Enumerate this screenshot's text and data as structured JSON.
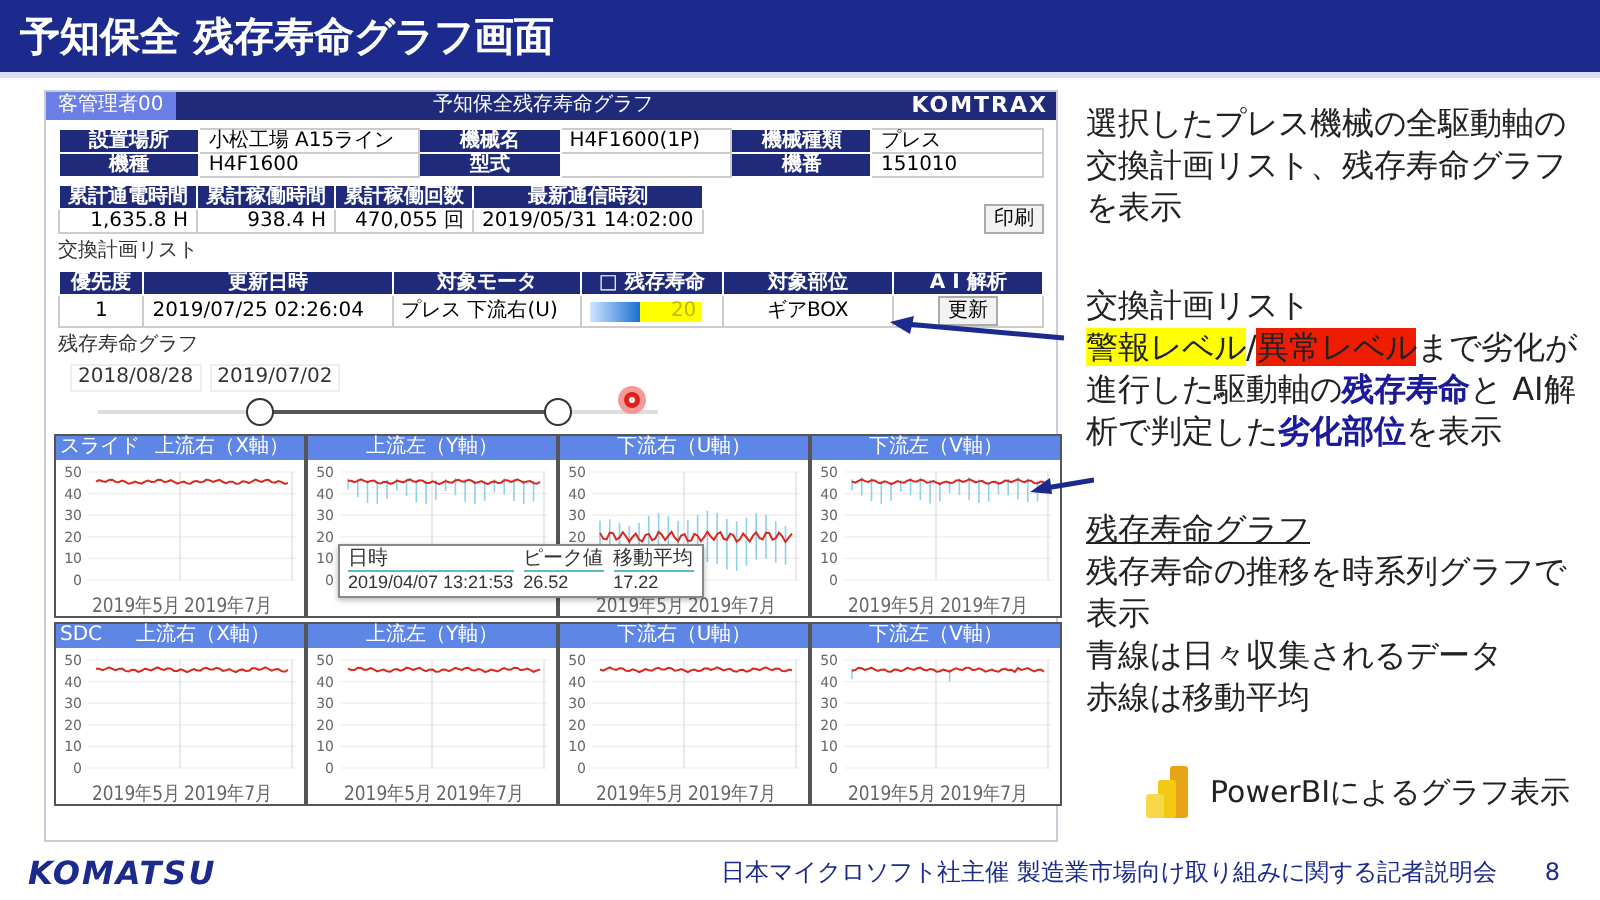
{
  "slide_title": "予知保全 残存寿命グラフ画面",
  "app": {
    "user": "客管理者00",
    "title": "予知保全残存寿命グラフ",
    "brand": "KOMTRAX",
    "info_rows": [
      [
        "設置場所",
        "小松工場 A15ライン",
        "機械名",
        "H4F1600(1P)",
        "機械種類",
        "プレス"
      ],
      [
        "機種",
        "H4F1600",
        "型式",
        "",
        "機番",
        "151010"
      ]
    ],
    "stats": {
      "columns": [
        "累計通電時間",
        "累計稼働時間",
        "累計稼働回数",
        "最新通信時刻"
      ],
      "values": [
        "1,635.8 H",
        "938.4 H",
        "470,055 回",
        "2019/05/31 14:02:00"
      ]
    },
    "print_button": "印刷",
    "list_title": "交換計画リスト",
    "list_columns": [
      "優先度",
      "更新日時",
      "対象モータ",
      "□ 残存寿命",
      "対象部位",
      "A I 解析"
    ],
    "list_rows": [
      {
        "priority": "1",
        "updated": "2019/07/25 02:26:04",
        "motor": "プレス 下流右(U)",
        "life": {
          "level": 0.45,
          "value": "20",
          "color": "#ffff00"
        },
        "part": "ギアBOX",
        "action": "更新"
      }
    ],
    "graph_title": "残存寿命グラフ",
    "dates": [
      "2018/08/28",
      "2019/07/02"
    ],
    "range_handles": [
      {
        "level": 0.29
      },
      {
        "level": 0.82
      }
    ],
    "chart_rows": [
      {
        "label": "スライド",
        "charts": [
          {
            "title": "上流右（X軸）",
            "kind": "flat",
            "y_labels": [
              "50",
              "40",
              "30",
              "20",
              "10",
              "0"
            ],
            "x_labels": [
              "2019年5月",
              "2019年7月"
            ]
          },
          {
            "title": "上流左（Y軸）",
            "kind": "spiky",
            "y_labels": [
              "50",
              "40",
              "30",
              "20",
              "10",
              "0"
            ]
          },
          {
            "title": "下流右（U軸）",
            "kind": "low",
            "y_labels": [
              "50",
              "40",
              "30",
              "20"
            ],
            "x_labels": [
              "2019年5月",
              "2019年7月"
            ]
          },
          {
            "title": "下流左（V軸）",
            "kind": "spiky",
            "y_labels": [
              "50",
              "40",
              "30",
              "20",
              "10",
              "0"
            ],
            "x_labels": [
              "2019年5月",
              "2019年7月"
            ]
          }
        ]
      },
      {
        "label": "SDC",
        "charts": [
          {
            "title": "上流右（X軸）",
            "kind": "flat",
            "y_labels": [
              "50",
              "40",
              "30",
              "20",
              "10",
              "0"
            ],
            "x_labels": [
              "2019年5月",
              "2019年7月"
            ]
          },
          {
            "title": "上流左（Y軸）",
            "kind": "flat",
            "y_labels": [
              "50",
              "40",
              "30",
              "20",
              "10",
              "0"
            ],
            "x_labels": [
              "2019年5月",
              "2019年7月"
            ]
          },
          {
            "title": "下流右（U軸）",
            "kind": "flat",
            "y_labels": [
              "50",
              "40",
              "30",
              "20",
              "10",
              "0"
            ],
            "x_labels": [
              "2019年5月",
              "2019年7月"
            ]
          },
          {
            "title": "下流左（V軸）",
            "kind": "dip",
            "y_labels": [
              "50",
              "40",
              "30",
              "20",
              "10",
              "0"
            ],
            "x_labels": [
              "2019年5月",
              "2019年7月"
            ]
          }
        ]
      }
    ],
    "tooltip": {
      "columns": [
        "日時",
        "ピーク値",
        "移動平均"
      ],
      "values": [
        "2019/04/07 13:21:53",
        "26.52",
        "17.22"
      ]
    }
  },
  "notes": [
    {
      "kind": "plain",
      "lines": [
        "選択したプレス機械の全駆動軸の交換計画リスト、残存寿命グラフを表示"
      ]
    },
    {
      "kind": "list",
      "heading": "交換計画リスト",
      "segments": [
        {
          "kind": "warning",
          "text": "警報レベル"
        },
        {
          "kind": "plain",
          "text": "/"
        },
        {
          "kind": "alarm",
          "text": "異常レベル"
        },
        {
          "kind": "plain",
          "text": "まで劣化が進行した駆動軸の"
        },
        {
          "kind": "emph",
          "text": "残存寿命"
        },
        {
          "kind": "plain",
          "text": "と AI解析で判定した"
        },
        {
          "kind": "emph",
          "text": "劣化部位"
        },
        {
          "kind": "plain",
          "text": "を表示"
        }
      ]
    },
    {
      "kind": "graph",
      "heading": "残存寿命グラフ",
      "lines": [
        "残存寿命の推移を時系列グラフで表示",
        "青線は日々収集されるデータ",
        "赤線は移動平均"
      ]
    }
  ],
  "powerbi_label": "PowerBIによるグラフ表示",
  "footer": {
    "logo": "KOMATSU",
    "text": "日本マイクロソフト社主催 製造業市場向け取り組みに関する記者説明会",
    "page": "8"
  }
}
